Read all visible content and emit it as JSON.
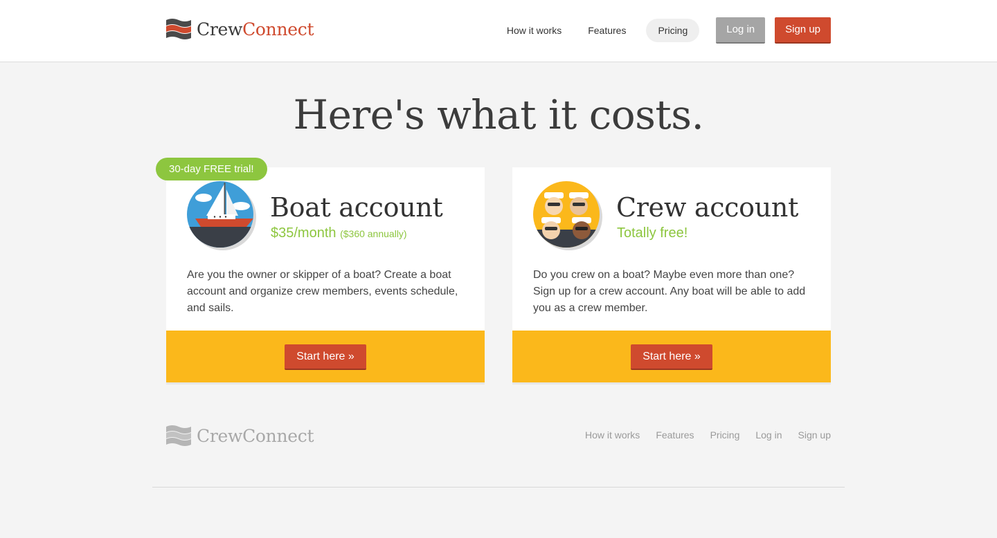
{
  "brand": {
    "name_part1": "Crew",
    "name_part2": "Connect"
  },
  "nav": {
    "how_it_works": "How it works",
    "features": "Features",
    "pricing": "Pricing",
    "login": "Log in",
    "signup": "Sign up"
  },
  "headline": "Here's what it costs.",
  "trial_badge": "30-day FREE trial!",
  "cards": [
    {
      "title": "Boat account",
      "price": "$35/month",
      "price_note": "($360 annually)",
      "description": "Are you the owner or skipper of a boat? Create a boat account and organize crew members, events schedule, and sails.",
      "button": "Start here »"
    },
    {
      "title": "Crew account",
      "price": "Totally free!",
      "price_note": "",
      "description": "Do you crew on a boat? Maybe even more than one? Sign up for a crew account. Any boat will be able to add you as a crew member.",
      "button": "Start here »"
    }
  ],
  "footer": {
    "how_it_works": "How it works",
    "features": "Features",
    "pricing": "Pricing",
    "login": "Log in",
    "signup": "Sign up"
  },
  "colors": {
    "accent": "#cf4a2e",
    "green": "#8dc63f",
    "yellow": "#fbb81b",
    "gray_button": "#a5a5a5"
  },
  "icons": [
    "crewconnect-logo-icon",
    "sailboat-icon",
    "crew-faces-icon"
  ]
}
